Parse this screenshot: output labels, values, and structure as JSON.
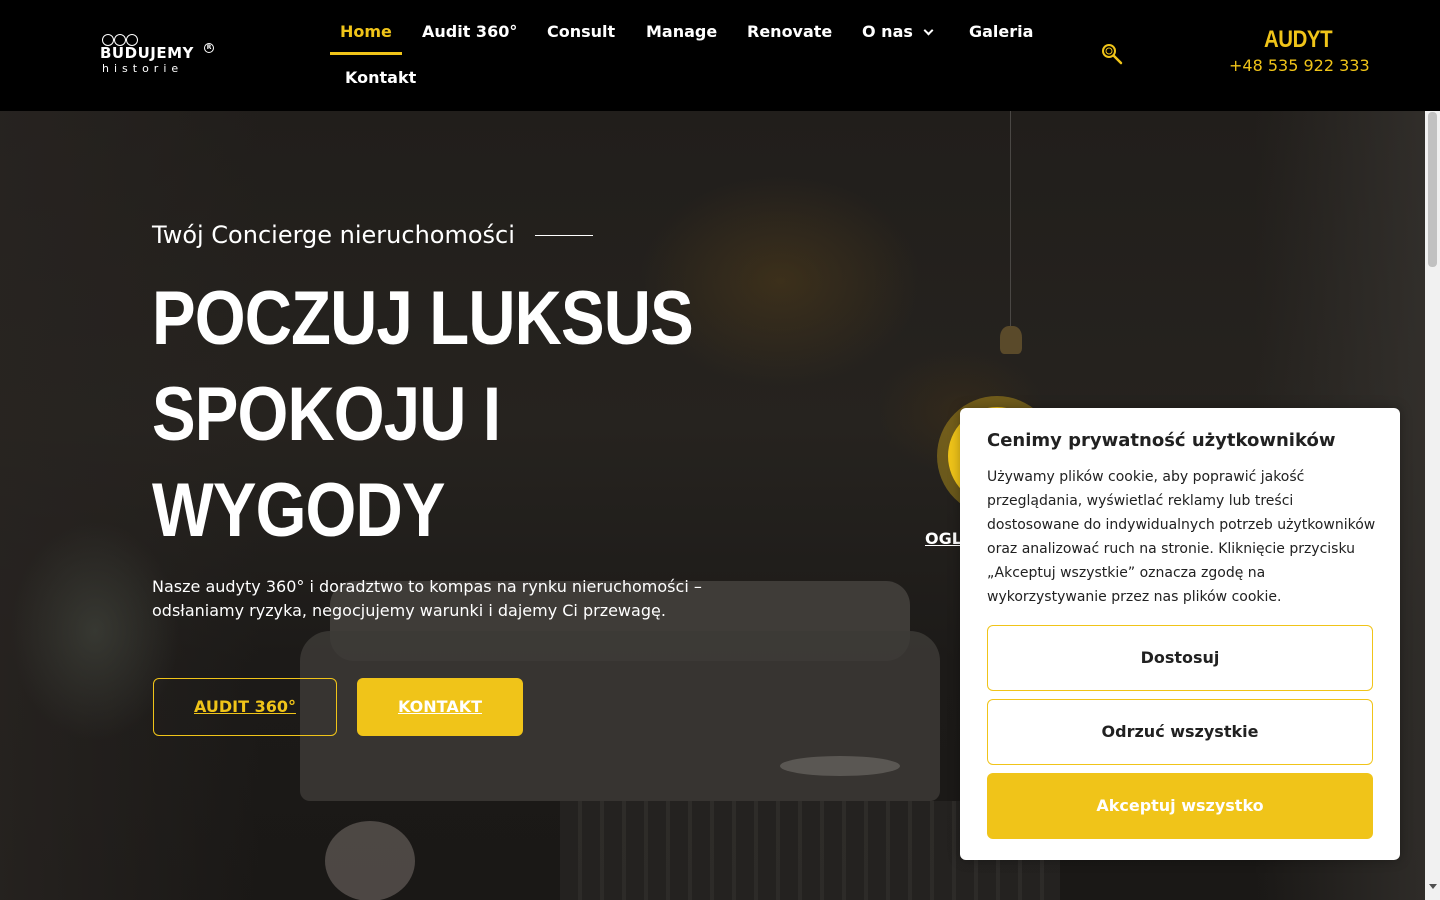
{
  "brand": {
    "logo_main": "BUDUJEMY",
    "logo_sub": "historie",
    "logo_reg": "R"
  },
  "nav": {
    "items": [
      {
        "label": "Home",
        "active": true
      },
      {
        "label": "Audit 360°"
      },
      {
        "label": "Consult"
      },
      {
        "label": "Manage"
      },
      {
        "label": "Renovate"
      },
      {
        "label": "O nas",
        "has_dropdown": true
      },
      {
        "label": "Galeria"
      },
      {
        "label": "Kontakt"
      }
    ],
    "search_icon": "search-icon"
  },
  "header_cta": {
    "title": "AUDYT",
    "phone": "+48 535 922 333"
  },
  "hero": {
    "kicker": "Twój Concierge nieruchomości",
    "headline_lines": [
      "POCZUJ LUKSUS",
      "SPOKOJU I",
      "WYGODY"
    ],
    "description": "Nasze audyty 360° i doradztwo to kompas na rynku nieruchomości – odsłaniamy ryzyka, negocjujemy warunki i dajemy Ci przewagę.",
    "btn_audit": "AUDIT 360°",
    "btn_contact": "KONTAKT",
    "watch_label": "OGL"
  },
  "cookie": {
    "title": "Cenimy prywatność użytkowników",
    "text": "Używamy plików cookie, aby poprawić jakość przeglądania, wyświetlać reklamy lub treści dostosowane do indywidualnych potrzeb użytkowników oraz analizować ruch na stronie. Kliknięcie przycisku „Akceptuj wszystkie” oznacza zgodę na wykorzystywanie przez nas plików cookie.",
    "btn_customize": "Dostosuj",
    "btn_reject": "Odrzuć wszystkie",
    "btn_accept": "Akceptuj wszystko"
  },
  "colors": {
    "accent": "#f0c419",
    "header_bg": "#000000",
    "modal_bg": "#ffffff",
    "text_dark": "#212121"
  }
}
